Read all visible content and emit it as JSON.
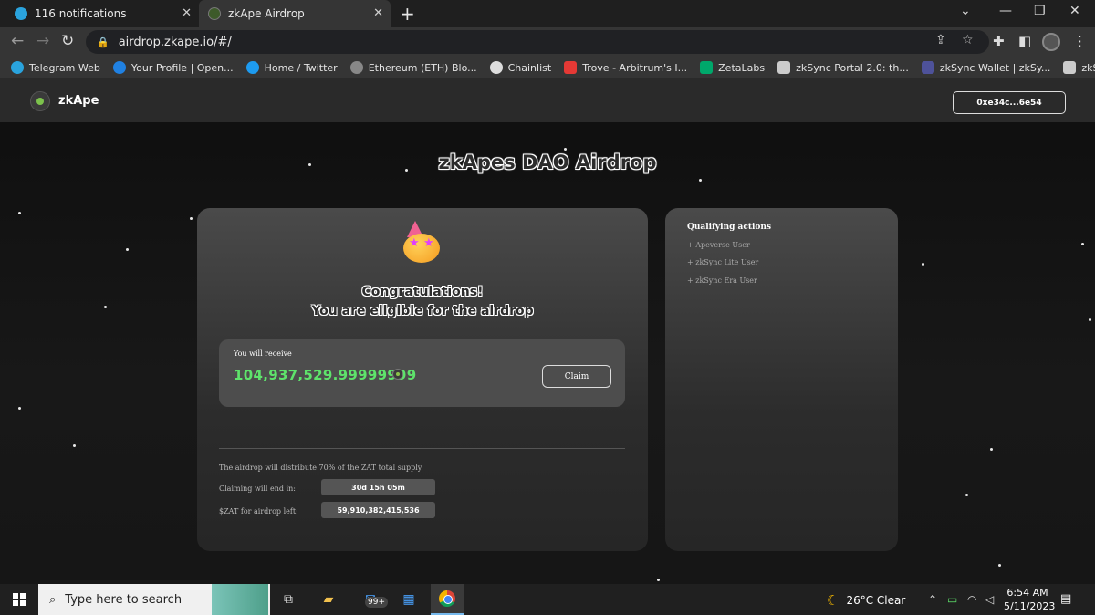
{
  "browser": {
    "tabs": [
      {
        "label": "116 notifications",
        "icon": "telegram-icon",
        "color": "#2aa3dd"
      },
      {
        "label": "zkApe Airdrop",
        "icon": "zkape-icon",
        "color": "#3d5a2a"
      }
    ],
    "url": "airdrop.zkape.io/#/",
    "bookmarks": [
      {
        "label": "Telegram Web",
        "color": "#2aa3dd"
      },
      {
        "label": "Your Profile | Open...",
        "color": "#2081e2"
      },
      {
        "label": "Home / Twitter",
        "color": "#1d9bf0"
      },
      {
        "label": "Ethereum (ETH) Blo...",
        "color": "#888888"
      },
      {
        "label": "Chainlist",
        "color": "#dddddd"
      },
      {
        "label": "Trove - Arbitrum's I...",
        "color": "#e53935"
      },
      {
        "label": "ZetaLabs",
        "color": "#00a86b"
      },
      {
        "label": "zkSync Portal 2.0: th...",
        "color": "#cccccc"
      },
      {
        "label": "zkSync Wallet | zkSy...",
        "color": "#4e529a"
      },
      {
        "label": "zkSync — Rely on...",
        "color": "#cccccc"
      }
    ]
  },
  "site": {
    "brand": "zkApe",
    "wallet": "0xe34c...6e54",
    "heading": "zkApes DAO Airdrop"
  },
  "claim_card": {
    "congrats_line1": "Congratulations!",
    "congrats_line2": "You are eligible for the airdrop",
    "receive_label": "You will receive",
    "amount": "104,937,529.99999999",
    "claim_label": "Claim",
    "distribution_note": "The airdrop will distribute 70% of the ZAT total supply.",
    "ends_label": "Claiming will end in:",
    "ends_value": "30d 15h 05m",
    "left_label": "$ZAT for airdrop left:",
    "left_value": "59,910,382,415,536"
  },
  "qualifying": {
    "title": "Qualifying actions",
    "items": [
      "+ Apeverse User",
      "+ zkSync Lite User",
      "+ zkSync Era User"
    ]
  },
  "taskbar": {
    "search_placeholder": "Type here to search",
    "mail_badge": "99+",
    "weather": "26°C  Clear",
    "time": "6:54 AM",
    "date": "5/11/2023",
    "notif_count": "1"
  },
  "colors": {
    "amount_green": "#5ee36b",
    "page_bg": "#111111"
  }
}
